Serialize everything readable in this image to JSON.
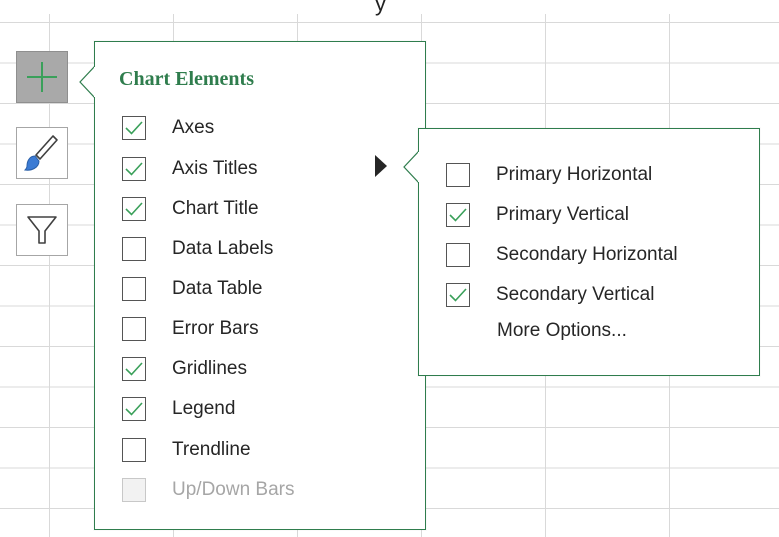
{
  "chart_buttons": {
    "add_element_icon": "plus-icon",
    "style_icon": "paintbrush-icon",
    "filter_icon": "funnel-icon"
  },
  "chart_elements_panel": {
    "title": "Chart Elements",
    "items": [
      {
        "label": "Axes",
        "checked": true,
        "enabled": true
      },
      {
        "label": "Axis Titles",
        "checked": true,
        "enabled": true
      },
      {
        "label": "Chart Title",
        "checked": true,
        "enabled": true
      },
      {
        "label": "Data Labels",
        "checked": false,
        "enabled": true
      },
      {
        "label": "Data Table",
        "checked": false,
        "enabled": true
      },
      {
        "label": "Error Bars",
        "checked": false,
        "enabled": true
      },
      {
        "label": "Gridlines",
        "checked": true,
        "enabled": true
      },
      {
        "label": "Legend",
        "checked": true,
        "enabled": true
      },
      {
        "label": "Trendline",
        "checked": false,
        "enabled": true
      },
      {
        "label": "Up/Down Bars",
        "checked": false,
        "enabled": false
      }
    ]
  },
  "axis_titles_submenu": {
    "items": [
      {
        "label": "Primary Horizontal",
        "checked": false
      },
      {
        "label": "Primary Vertical",
        "checked": true
      },
      {
        "label": "Secondary Horizontal",
        "checked": false
      },
      {
        "label": "Secondary Vertical",
        "checked": true
      }
    ],
    "more_options": "More Options..."
  },
  "colors": {
    "accent_green": "#2f7d4d",
    "check_green": "#3aa05a"
  }
}
